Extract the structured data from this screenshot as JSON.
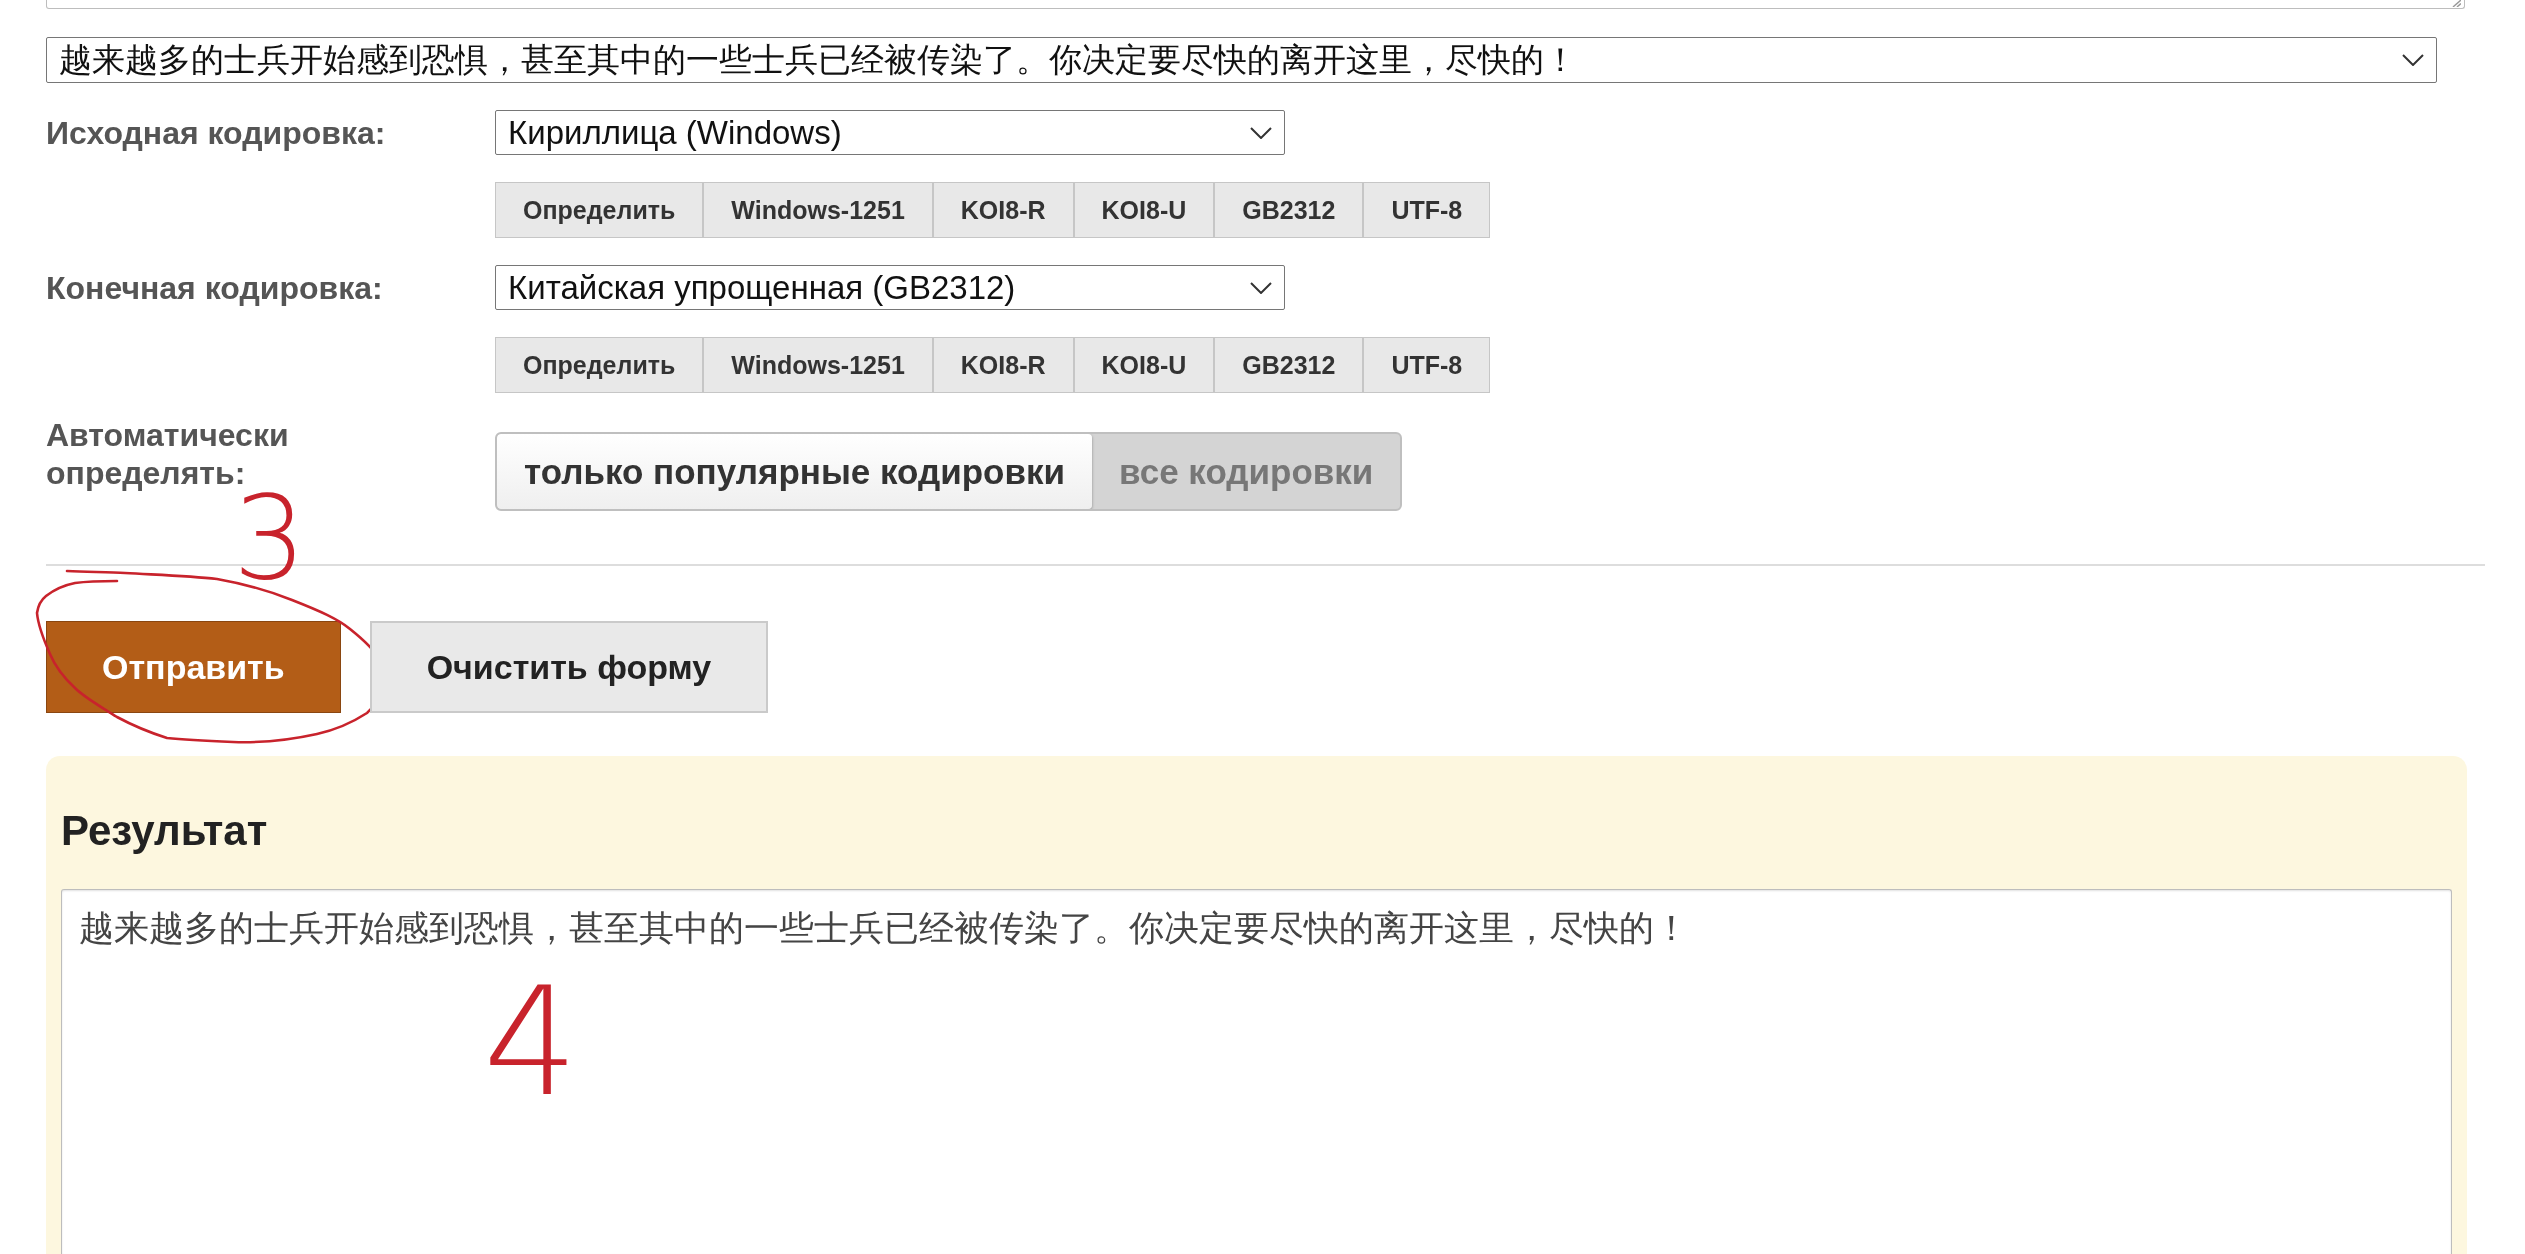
{
  "text_input": {
    "resizable": true
  },
  "text_select": {
    "value": "越来越多的士兵开始感到恐惧，甚至其中的一些士兵已经被传染了。你决定要尽快的离开这里，尽快的！"
  },
  "source_encoding": {
    "label": "Исходная кодировка:",
    "value": "Кириллица (Windows)",
    "quick_buttons": [
      "Определить",
      "Windows-1251",
      "KOI8-R",
      "KOI8-U",
      "GB2312",
      "UTF-8"
    ]
  },
  "target_encoding": {
    "label": "Конечная кодировка:",
    "value": "Китайская упрощенная (GB2312)",
    "quick_buttons": [
      "Определить",
      "Windows-1251",
      "KOI8-R",
      "KOI8-U",
      "GB2312",
      "UTF-8"
    ]
  },
  "auto_detect": {
    "label": "Автоматически определять:",
    "options": [
      {
        "label": "только популярные кодировки",
        "selected": true
      },
      {
        "label": "все кодировки",
        "selected": false
      }
    ],
    "handwritten_note": "3"
  },
  "actions": [
    {
      "label": "Отправить",
      "kind": "primary",
      "circled": true
    },
    {
      "label": "Очистить форму",
      "kind": "secondary",
      "circled": false
    }
  ],
  "result": {
    "title": "Результат",
    "text": "越来越多的士兵开始感到恐惧，甚至其中的一些士兵已经被传染了。你决定要尽快的离开这里，尽快的！",
    "handwritten_note": "4"
  }
}
